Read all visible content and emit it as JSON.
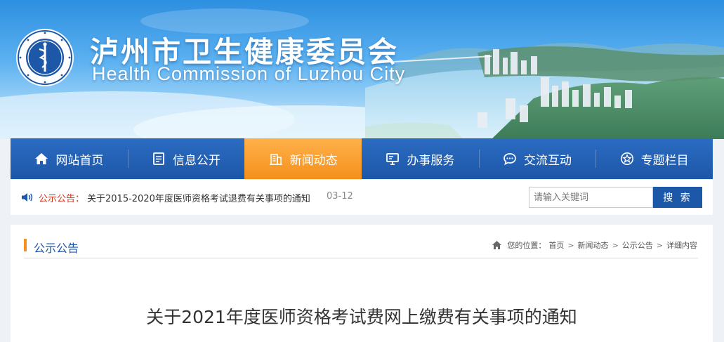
{
  "header": {
    "title": "泸州市卫生健康委员会",
    "subtitle": "Health Commission of Luzhou City",
    "logo_icon": "health-emblem-icon"
  },
  "nav": {
    "items": [
      {
        "label": "网站首页",
        "icon": "home-icon"
      },
      {
        "label": "信息公开",
        "icon": "document-icon"
      },
      {
        "label": "新闻动态",
        "icon": "building-icon",
        "active": true
      },
      {
        "label": "办事服务",
        "icon": "monitor-icon"
      },
      {
        "label": "交流互动",
        "icon": "chat-icon"
      },
      {
        "label": "专题栏目",
        "icon": "star-icon"
      }
    ]
  },
  "notice": {
    "label": "公示公告：",
    "text": "关于2015-2020年度医师资格考试退费有关事项的通知",
    "date": "03-12"
  },
  "search": {
    "placeholder": "请输入关键词",
    "button_label": "搜 索"
  },
  "section": {
    "title": "公示公告",
    "breadcrumb": {
      "prefix": "您的位置：",
      "items": [
        "首页",
        "新闻动态",
        "公示公告",
        "详细内容"
      ],
      "separator": ">"
    }
  },
  "article": {
    "title": "关于2021年度医师资格考试费网上缴费有关事项的通知"
  },
  "colors": {
    "nav_blue": "#1d57a8",
    "nav_active_orange": "#f5901c",
    "notice_red": "#d0341f",
    "section_title_blue": "#1d57a8"
  }
}
